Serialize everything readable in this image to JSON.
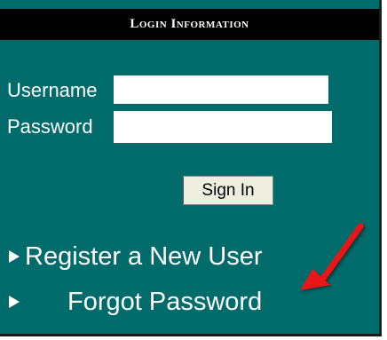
{
  "panel": {
    "title": "Login Information",
    "background_color": "#006b6b"
  },
  "form": {
    "username_label": "Username",
    "username_value": "",
    "password_label": "Password",
    "password_value": "",
    "signin_label": "Sign In"
  },
  "links": {
    "register_label": "Register a New User",
    "forgot_label": "Forgot Password"
  },
  "annotation": {
    "arrow_color": "#e81818",
    "arrow_icon": "red-arrow-icon"
  }
}
